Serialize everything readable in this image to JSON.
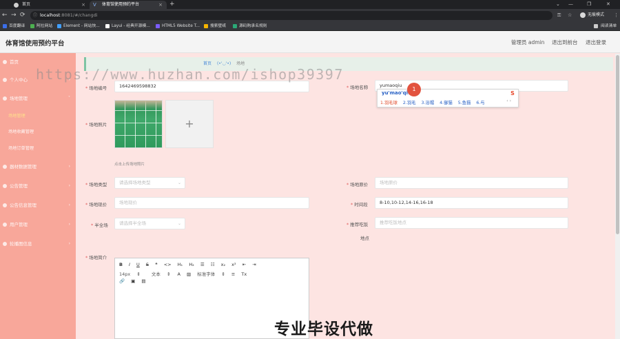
{
  "browser": {
    "tabs": [
      {
        "label": "首页",
        "close": "×"
      },
      {
        "label": "体育馆使用预约平台",
        "icon": "V",
        "close": "×"
      }
    ],
    "new_tab": "+",
    "window_controls": {
      "minimize": "—",
      "maximize": "❐",
      "close": "✕"
    },
    "tab_overflow": "⌄",
    "nav": {
      "back": "←",
      "forward": "→",
      "reload": "⟳"
    },
    "address": {
      "host": "localhost",
      "rest": ":8081/#/changdi",
      "info": "ⓘ"
    },
    "profile_label": "无痕模式",
    "bookmarks": [
      {
        "label": "百度翻译",
        "color": "#3b6ee8"
      },
      {
        "label": "阿拉网站",
        "color": "#4caf50"
      },
      {
        "label": "Element - 网站快...",
        "color": "#409eff"
      },
      {
        "label": "Layui - 经典开源模...",
        "color": "#ffffff"
      },
      {
        "label": "HTML5 Website T...",
        "color": "#7b5cff"
      },
      {
        "label": "搜索壁纸",
        "color": "#f5b400"
      },
      {
        "label": "源码购承名规则",
        "color": "#2aa876"
      }
    ],
    "reading_list": "阅读清单"
  },
  "header": {
    "title": "体育馆使用预约平台",
    "admin": "管理员 admin",
    "back_to_front": "退出到前台",
    "logout": "退出登录"
  },
  "sidebar": {
    "items": [
      {
        "label": "首页"
      },
      {
        "label": "个人中心",
        "caret": "›"
      },
      {
        "label": "场地管理",
        "caret": "˅"
      },
      {
        "label": "场地管理",
        "active": true
      },
      {
        "label": "场地收藏管理"
      },
      {
        "label": "场地订单管理"
      },
      {
        "label": "器材数据管理",
        "caret": "›"
      },
      {
        "label": "公告管理",
        "caret": "›"
      },
      {
        "label": "公告信息管理",
        "caret": "›"
      },
      {
        "label": "用户管理",
        "caret": "›"
      },
      {
        "label": "轮播图信息",
        "caret": "›"
      }
    ]
  },
  "breadcrumb": {
    "home": "首页",
    "face": "(•'◡'•)",
    "current": "场地"
  },
  "watermark": "https://www.huzhan.com/ishop39397",
  "form": {
    "field_code": {
      "label": "场地编号",
      "value": "1642469598832"
    },
    "field_name": {
      "label": "场地名称",
      "value": "yumaoqiu"
    },
    "photo": {
      "label": "场地照片",
      "upload_plus": "+",
      "tip": "点击上传场地照片"
    },
    "type": {
      "label": "场地类型",
      "placeholder": "请选择场地类型"
    },
    "orig_price": {
      "label": "场地原价",
      "placeholder": "场地原价"
    },
    "now_price": {
      "label": "场地现价",
      "placeholder": "场地现价"
    },
    "time_slot": {
      "label": "时间段",
      "value": "8-10,10-12,14-16,16-18"
    },
    "full_court": {
      "label": "半全场",
      "placeholder": "请选择半全场"
    },
    "recommend": {
      "label": "推荐吃饭",
      "label2": "地点",
      "placeholder": "推荐吃饭地点"
    },
    "intro": {
      "label": "场地简介"
    }
  },
  "ime": {
    "pinyin": "yu'mao'qiu",
    "candidates": [
      "1.羽毛球",
      "2.羽毛",
      "3.浴帽",
      "4.御猫",
      "5.鱼猫",
      "6.与"
    ],
    "nav": "‹  ›",
    "logo": "S",
    "cursor_number": "1"
  },
  "editor": {
    "toolbar_row1": [
      "B",
      "I",
      "U",
      "S",
      "❝",
      "<>",
      "H₁",
      "H₂",
      "☰",
      "☷",
      "x₂",
      "x²",
      "⇤",
      "⇥"
    ],
    "toolbar_row2": [
      "14px",
      "⇕",
      "文本",
      "⇕",
      "A",
      "▨",
      "标准字体",
      "⇕",
      "≡",
      "Tx"
    ],
    "toolbar_row3": [
      "🔗",
      "▣",
      "▤"
    ]
  },
  "caption": "专业毕设代做"
}
